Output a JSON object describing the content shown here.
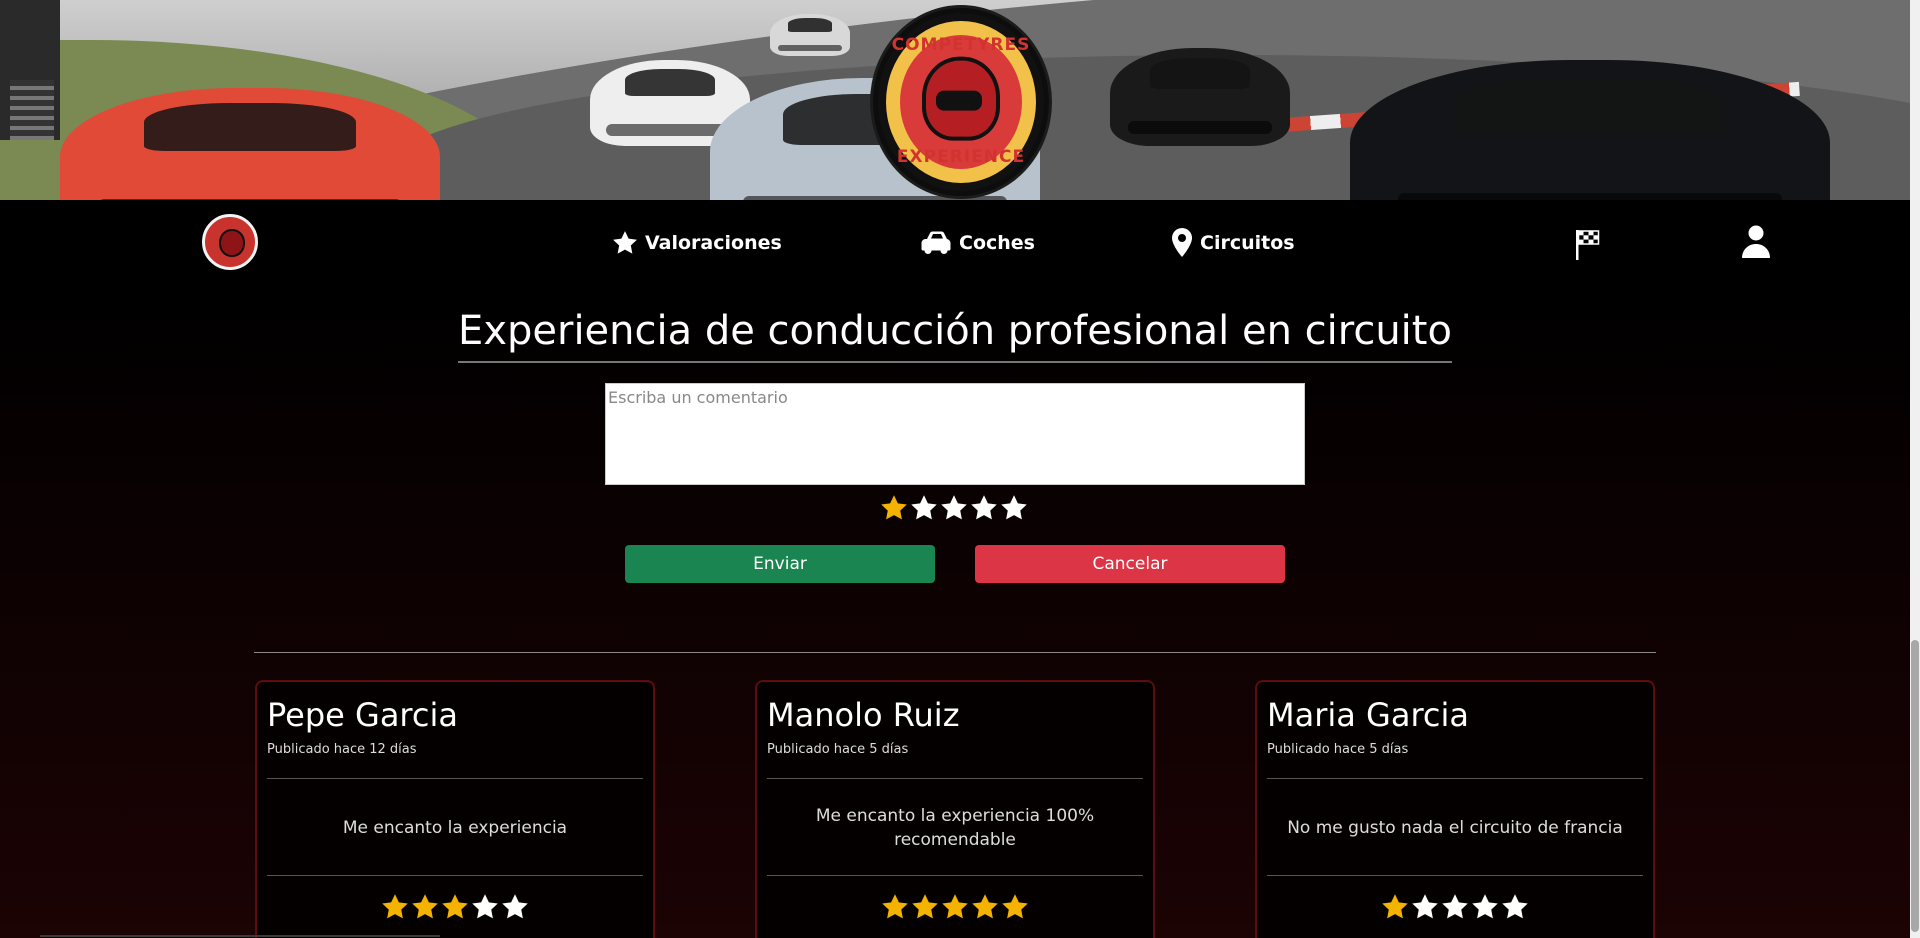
{
  "hero": {
    "badge_top": "COMPETYRES",
    "badge_bottom": "EXPERIENCE"
  },
  "nav": {
    "logo_text": "COMPETYRES EXPERIENCE",
    "items": [
      {
        "label": "Valoraciones",
        "icon": "star-icon"
      },
      {
        "label": "Coches",
        "icon": "car-icon"
      },
      {
        "label": "Circuitos",
        "icon": "location-pin-icon"
      }
    ],
    "right_icons": [
      "checkered-flag-icon",
      "user-icon"
    ]
  },
  "form": {
    "title": "Experiencia de conducción profesional en circuito",
    "comment_placeholder": "Escriba un comentario",
    "comment_value": "",
    "rating": 1,
    "rating_max": 5,
    "send_label": "Enviar",
    "cancel_label": "Cancelar"
  },
  "reviews": [
    {
      "author": "Pepe Garcia",
      "date": "Publicado hace 12 días",
      "comment": "Me encanto la experiencia",
      "rating": 3
    },
    {
      "author": "Manolo Ruiz",
      "date": "Publicado hace 5 días",
      "comment": "Me encanto la experiencia 100% recomendable",
      "rating": 5
    },
    {
      "author": "Maria Garcia",
      "date": "Publicado hace 5 días",
      "comment": "No me gusto nada el circuito de francia",
      "rating": 1
    }
  ],
  "colors": {
    "star_on": "#f5b301",
    "star_off": "#ffffff",
    "send_button": "#1b8552",
    "cancel_button": "#dc3545",
    "card_border": "#5d0d0d"
  }
}
